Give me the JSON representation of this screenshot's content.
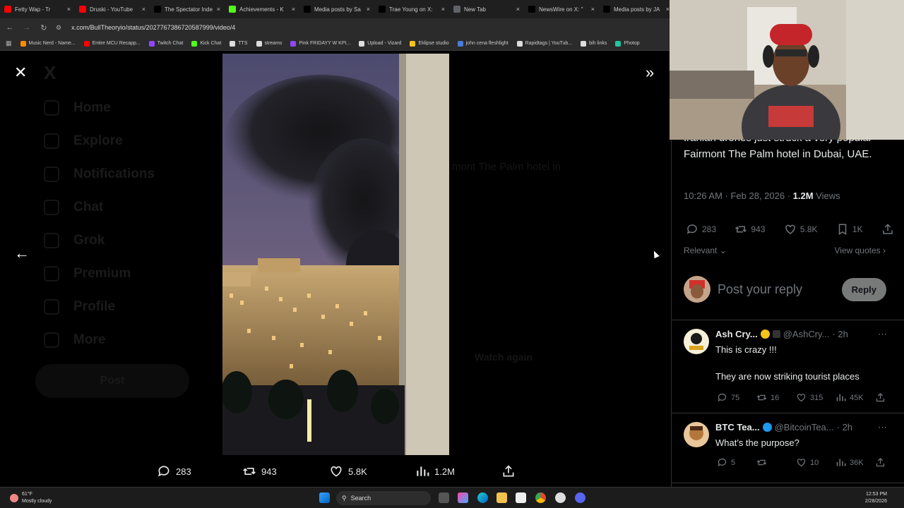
{
  "browser": {
    "tabs": [
      {
        "title": "Fetty Wap - Tr",
        "icon": "youtube-icon",
        "color": "#ff0000"
      },
      {
        "title": "Druski - YouTube",
        "icon": "youtube-icon",
        "color": "#ff0000"
      },
      {
        "title": "The Spectator Inde",
        "icon": "x-icon",
        "color": "#000000"
      },
      {
        "title": "Achievements - K",
        "icon": "kick-icon",
        "color": "#53fc18"
      },
      {
        "title": "Media posts by Sa",
        "icon": "x-icon",
        "color": "#000000"
      },
      {
        "title": "Trae Young on X:",
        "icon": "x-icon",
        "color": "#000000"
      },
      {
        "title": "New Tab",
        "icon": "globe-icon",
        "color": "#5f6368"
      },
      {
        "title": "NewsWire on X: \"",
        "icon": "x-icon",
        "color": "#000000"
      },
      {
        "title": "Media posts by JA",
        "icon": "x-icon",
        "color": "#000000"
      }
    ],
    "url": "x.com/BullTheoryio/status/2027767386720587999/video/4",
    "bookmarks": [
      {
        "label": "Music Nerd - Name...",
        "color": "#ff8a00"
      },
      {
        "label": "Entire MCU Recapp...",
        "color": "#ff0000"
      },
      {
        "label": "Twitch Chat",
        "color": "#9146ff"
      },
      {
        "label": "Kick Chat",
        "color": "#53fc18"
      },
      {
        "label": "TTS",
        "color": "#dddddd"
      },
      {
        "label": "streams",
        "color": "#dddddd"
      },
      {
        "label": "Pink FRIDAYY W KPI...",
        "color": "#9146ff"
      },
      {
        "label": "Upload - Vizard",
        "color": "#dddddd"
      },
      {
        "label": "Eklipse studio",
        "color": "#f5c518"
      },
      {
        "label": "john cena fleshlight",
        "color": "#4a7bd6"
      },
      {
        "label": "Rapidtags | YouTub...",
        "color": "#dddddd"
      },
      {
        "label": "bih links",
        "color": "#dddddd"
      },
      {
        "label": "Photop",
        "color": "#1ec8a0"
      }
    ]
  },
  "background_nav": [
    "Home",
    "Explore",
    "Notifications",
    "Chat",
    "Grok",
    "Premium",
    "Profile",
    "More"
  ],
  "background_post_button": "Post",
  "background_watch_again": "Watch again",
  "background_text_fragment": "mont The Palm hotel in",
  "video_stats": {
    "replies": "283",
    "reposts": "943",
    "likes": "5.8K",
    "views": "1.2M"
  },
  "tweet": {
    "text": "Iranian drones just struck a very popular Fairmont The Palm hotel in Dubai, UAE.",
    "time": "10:26 AM · Feb 28, 2026 · ",
    "views_count": "1.2M",
    "views_label": " Views",
    "actions": {
      "replies": "283",
      "reposts": "943",
      "likes": "5.8K",
      "bookmarks": "1K"
    },
    "sort_label": "Relevant",
    "view_quotes": "View quotes",
    "reply_placeholder": "Post your reply",
    "reply_button": "Reply"
  },
  "replies": [
    {
      "name": "Ash Cry...",
      "handle": "@AshCry...",
      "time": "· 2h",
      "line1": "This is crazy !!!",
      "line2": "They are now striking tourist places",
      "replies": "75",
      "reposts": "16",
      "likes": "315",
      "views": "45K",
      "verified_color": "#f4c41a"
    },
    {
      "name": "BTC Tea...",
      "handle": "@BitcoinTea...",
      "time": "· 2h",
      "line1": "What's the purpose?",
      "line2": "",
      "replies": "5",
      "reposts": "",
      "likes": "10",
      "views": "36K",
      "verified_color": "#1d9bf0"
    }
  ],
  "taskbar": {
    "weather_temp": "61°F",
    "weather_desc": "Mostly cloudy",
    "search_label": "Search",
    "time": "12:53 PM",
    "date": "2/28/2026"
  }
}
